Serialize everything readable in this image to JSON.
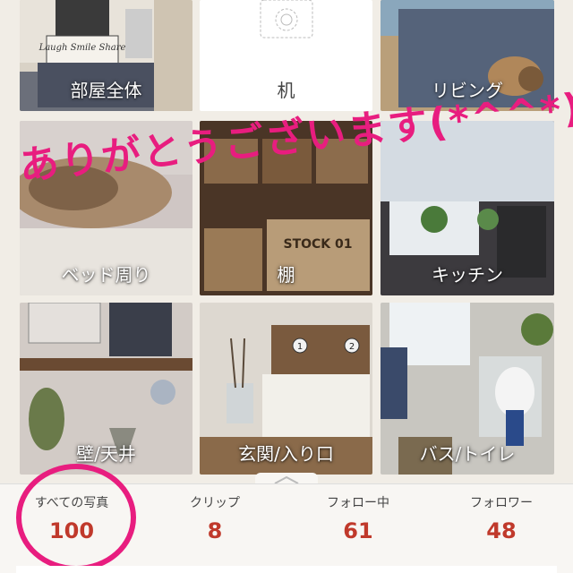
{
  "tiles": [
    {
      "label": "部屋全体"
    },
    {
      "label": "机"
    },
    {
      "label": "リビング"
    },
    {
      "label": "ベッド周り"
    },
    {
      "label": "棚"
    },
    {
      "label": "キッチン"
    },
    {
      "label": "壁/天井"
    },
    {
      "label": "玄関/入り口"
    },
    {
      "label": "バス/トイレ"
    }
  ],
  "overlay_text": "ありがとうございます(*^^*)",
  "stats": [
    {
      "name": "すべての写真",
      "value": "100"
    },
    {
      "name": "クリップ",
      "value": "8"
    },
    {
      "name": "フォロー中",
      "value": "61"
    },
    {
      "name": "フォロワー",
      "value": "48"
    }
  ],
  "colors": {
    "accent": "#e81d7f",
    "stat_value": "#c0392b",
    "background": "#f1ede6"
  },
  "photo_texts": {
    "pillow": "Laugh Smile Share",
    "crate": "STOCK 01",
    "drawer_left": "1",
    "drawer_right": "2"
  }
}
